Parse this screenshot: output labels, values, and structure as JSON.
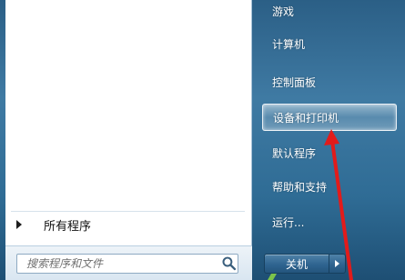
{
  "colors": {
    "accent_arrow": "#e21b1b",
    "panel_blue": "#2f6c95",
    "left_bg": "#ffffff"
  },
  "left": {
    "all_programs_label": "所有程序",
    "search": {
      "placeholder": "搜索程序和文件",
      "value": "",
      "icon": "search-icon"
    }
  },
  "right": {
    "items": [
      {
        "label": "游戏"
      },
      {
        "label": "计算机"
      },
      {
        "label": "控制面板"
      },
      {
        "label": "设备和打印机",
        "highlighted": true
      },
      {
        "label": "默认程序"
      },
      {
        "label": "帮助和支持"
      },
      {
        "label": "运行..."
      }
    ]
  },
  "shutdown": {
    "label": "关机",
    "arrow_icon": "chevron-right-icon"
  },
  "annotation": {
    "type": "red-arrow",
    "points_to": "设备和打印机"
  }
}
